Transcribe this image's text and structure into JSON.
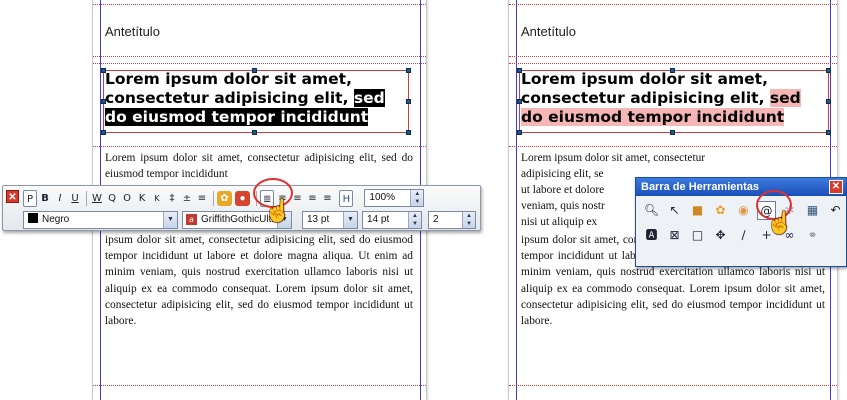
{
  "antetitulo": "Antetítulo",
  "headline": {
    "line1": "Lorem ipsum dolor sit amet,",
    "line2_pre": "consectetur adipisicing elit, ",
    "line2_sel": "sed",
    "line3": "do eiusmod tempor incididunt"
  },
  "body": {
    "top_left": "Lorem ipsum dolor sit amet, consectetur adipisicing elit, sed do eiusmod tempor incididunt",
    "bottom_left": "ipsum dolor sit amet, consectetur adipisicing elit, sed do eiusmod tempor incididunt ut labore et dolore magna aliqua. Ut enim ad minim veniam, quis nostrud exercitation ullamco laboris nisi ut aliquip ex ea commodo consequat. Lorem ipsum dolor sit amet, consectetur adipisicing elit, sed do eiusmod tempor incididunt ut labore.",
    "right_l1": "Lorem ipsum dolor sit amet, consectetur",
    "right_l2": "adipisicing elit, se",
    "right_l3": "ut labore et dolore",
    "right_l4": "veniam, quis nostr",
    "right_l5": "nisi ut aliquip ex",
    "bottom_right": "ipsum dolor sit amet, consectetur adipisicing elit, sed do eiusmod tempor incididunt ut labore et dolore magna aliqua. Ut enim ad minim veniam, quis nostrud exercitation ullamco laboris nisi ut aliquip ex ea commodo consequat. Lorem ipsum dolor sit amet, consectetur adipisicing elit, sed do eiusmod tempor incididunt ut labore."
  },
  "toolbar": {
    "row1": [
      "P",
      "B",
      "I",
      "U",
      "W",
      "Q",
      "O",
      "K",
      "K",
      "‡",
      "±",
      "≡"
    ],
    "align_buttons": [
      "≣",
      "≡",
      "≡",
      "≡",
      "≡"
    ],
    "h_label": "H",
    "zoom": "100%",
    "color_name": "Negro",
    "font_name": "GriffithGothicUltr",
    "font_size": "13 pt",
    "leading": "14 pt",
    "columns": "2"
  },
  "tools_panel": {
    "title": "Barra de Herramientas",
    "row1_icons": [
      "zoom-icon",
      "select-icon",
      "lock-icon",
      "group-icon",
      "color-icon",
      "link-icon",
      "unlink-icon",
      "grid-icon",
      "undo-icon"
    ],
    "row2_icons": [
      "text-box-icon",
      "image-box-icon",
      "rectangle-icon",
      "move-icon",
      "line-icon",
      "plus-icon",
      "chain-icon",
      "broken-chain-icon"
    ]
  },
  "colors": {
    "guide_blue": "#3a3ad6",
    "guide_red": "#d23a3a",
    "highlight_pink": "#f7b6b6",
    "callout_red": "#e03030"
  }
}
